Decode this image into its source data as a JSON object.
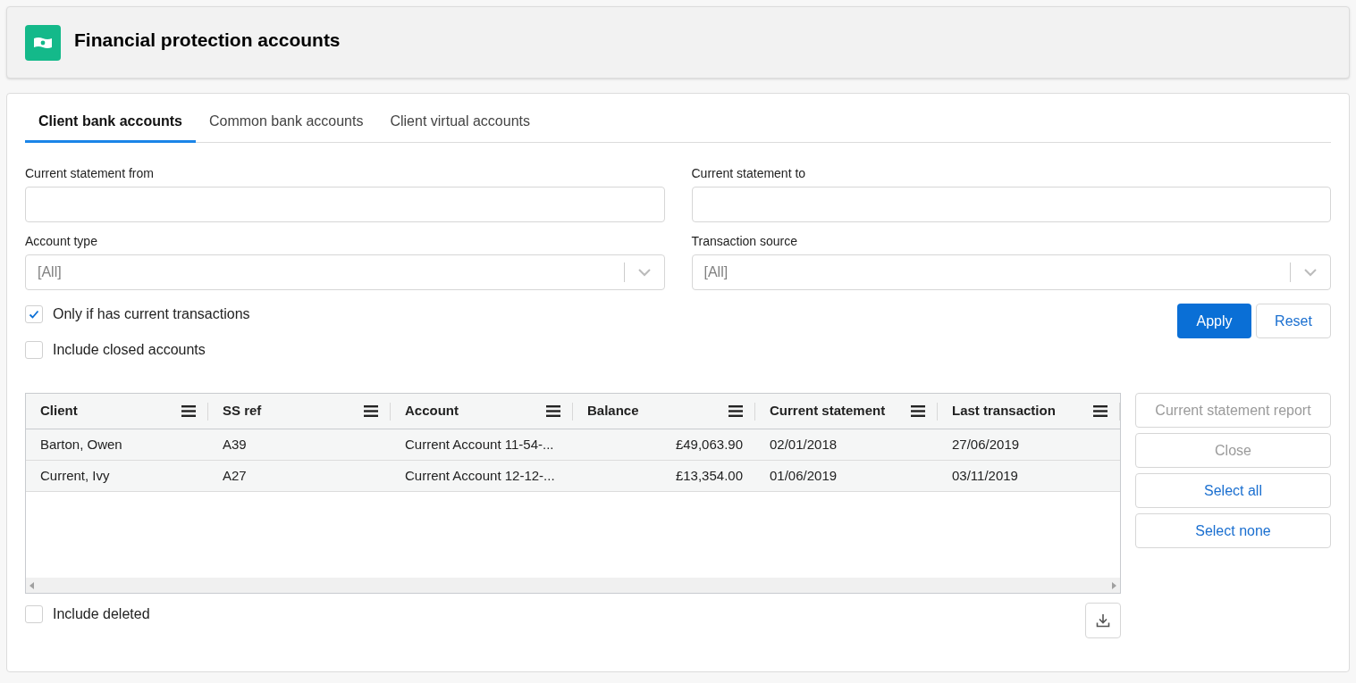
{
  "header": {
    "title": "Financial protection accounts"
  },
  "tabs": [
    {
      "label": "Client bank accounts",
      "selected": true
    },
    {
      "label": "Common bank accounts",
      "selected": false
    },
    {
      "label": "Client virtual accounts",
      "selected": false
    }
  ],
  "filters": [
    {
      "kind": "text",
      "label": "Current statement from"
    },
    {
      "kind": "text",
      "label": "Current statement to"
    },
    {
      "kind": "select",
      "label": "Account type",
      "value": "[All]"
    },
    {
      "kind": "select",
      "label": "Transaction source",
      "value": "[All]"
    }
  ],
  "options": [
    {
      "label": "Only if has current transactions",
      "checked": true
    },
    {
      "label": "Include closed accounts",
      "checked": false
    }
  ],
  "filter_buttons": [
    {
      "label": "Apply",
      "kind": "primary"
    },
    {
      "label": "Reset",
      "kind": "secondary"
    }
  ],
  "table": {
    "columns": [
      {
        "label": "Client",
        "kind": "text"
      },
      {
        "label": "SS ref",
        "kind": "text"
      },
      {
        "label": "Account",
        "kind": "text"
      },
      {
        "label": "Balance",
        "kind": "amount"
      },
      {
        "label": "Current statement",
        "kind": "text"
      },
      {
        "label": "Last transaction",
        "kind": "text"
      }
    ],
    "rows": [
      [
        "Barton, Owen",
        "A39",
        "Current Account 11-54-...",
        "£49,063.90",
        "02/01/2018",
        "27/06/2019"
      ],
      [
        "Current, Ivy",
        "A27",
        "Current Account 12-12-...",
        "£13,354.00",
        "01/06/2019",
        "03/11/2019"
      ]
    ]
  },
  "footer_option": {
    "label": "Include deleted",
    "checked": false
  },
  "side_buttons": [
    {
      "label": "Current statement report",
      "disabled": true
    },
    {
      "label": "Close",
      "disabled": true
    },
    {
      "label": "Select all",
      "disabled": false
    },
    {
      "label": "Select none",
      "disabled": false
    }
  ]
}
